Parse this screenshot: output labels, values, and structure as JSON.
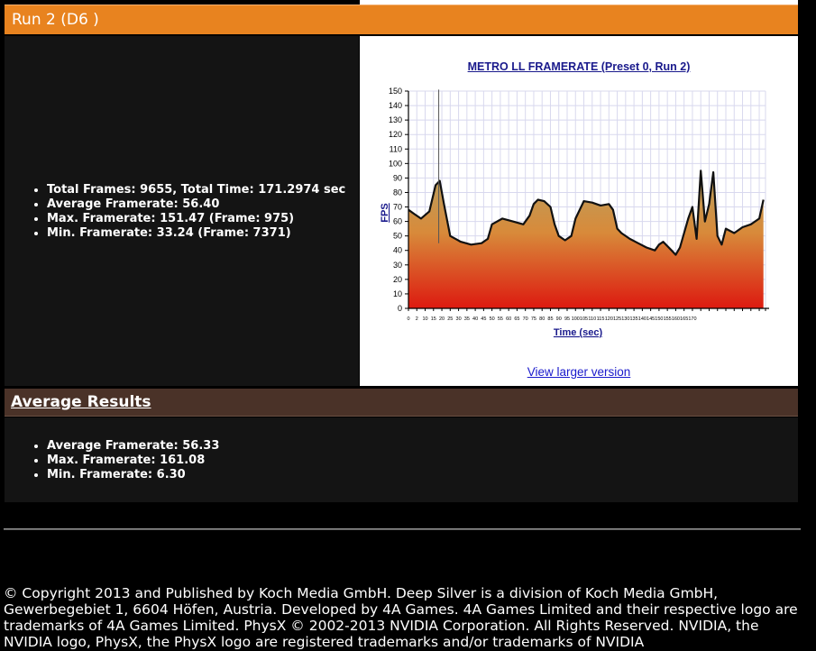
{
  "run": {
    "title": "Run 2 (D6 )",
    "stats": [
      "Total Frames: 9655, Total Time: 171.2974 sec",
      "Average Framerate: 56.40",
      "Max. Framerate: 151.47 (Frame: 975)",
      "Min. Framerate: 33.24 (Frame: 7371)"
    ]
  },
  "chart_panel": {
    "view_larger": "View larger version"
  },
  "chart_data": {
    "type": "area",
    "title": "METRO LL FRAMERATE (Preset 0, Run 2)",
    "xlabel": "Time (sec)",
    "ylabel": "FPS",
    "xlim": [
      0,
      171
    ],
    "ylim": [
      0,
      150
    ],
    "yticks": [
      0,
      10,
      20,
      30,
      40,
      50,
      60,
      70,
      80,
      90,
      100,
      110,
      120,
      130,
      140,
      150
    ],
    "xticks": [
      0,
      4,
      8,
      12,
      16,
      20,
      24,
      28,
      32,
      36,
      40,
      44,
      48,
      52,
      56,
      60,
      64,
      68,
      72,
      76,
      80,
      84,
      88,
      92,
      96,
      100,
      104,
      108,
      112,
      116,
      120,
      124,
      128,
      132,
      136,
      140,
      144,
      148,
      152,
      156,
      160,
      164,
      168,
      172
    ],
    "xtick_labels": [
      "0",
      "2",
      "10",
      "15",
      "20",
      "25",
      "30",
      "35",
      "40",
      "45",
      "50",
      "55",
      "60",
      "65",
      "70",
      "75",
      "80",
      "85",
      "90",
      "95",
      "100",
      "105",
      "110",
      "115",
      "120",
      "125",
      "130",
      "135",
      "140",
      "145",
      "150",
      "155",
      "160",
      "165",
      "170"
    ],
    "grid": true,
    "series": [
      {
        "x": [
          0,
          3,
          6,
          10,
          13,
          15,
          17,
          20,
          25,
          30,
          35,
          38,
          40,
          45,
          50,
          55,
          58,
          60,
          62,
          65,
          68,
          70,
          72,
          75,
          78,
          80,
          84,
          88,
          92,
          96,
          98,
          100,
          102,
          106,
          110,
          114,
          118,
          120,
          122,
          126,
          128,
          130,
          132,
          134,
          136,
          138,
          140,
          142,
          144,
          146,
          148,
          150,
          152,
          156,
          160,
          164,
          168,
          170
        ],
        "values": [
          68,
          65,
          62,
          67,
          85,
          88,
          72,
          50,
          46,
          44,
          45,
          48,
          58,
          62,
          60,
          58,
          64,
          72,
          75,
          74,
          70,
          58,
          50,
          47,
          50,
          62,
          74,
          73,
          71,
          72,
          68,
          55,
          52,
          48,
          45,
          42,
          40,
          44,
          46,
          40,
          37,
          42,
          52,
          62,
          70,
          48,
          95,
          60,
          72,
          94,
          50,
          44,
          55,
          52,
          56,
          58,
          62,
          75
        ]
      }
    ]
  },
  "average": {
    "title": "Average Results",
    "items": [
      "Average Framerate: 56.33",
      "Max. Framerate: 161.08",
      "Min. Framerate: 6.30"
    ]
  },
  "footer": {
    "text": "© Copyright 2013 and Published by Koch Media GmbH. Deep Silver is a division of Koch Media GmbH, Gewerbegebiet 1, 6604 Höfen, Austria. Developed by 4A Games. 4A Games Limited and their respective logo are trademarks of 4A Games Limited. PhysX © 2002-2013 NVIDIA Corporation. All Rights Reserved. NVIDIA, the NVIDIA logo, PhysX, the PhysX logo are registered trademarks and/or trademarks of NVIDIA"
  }
}
